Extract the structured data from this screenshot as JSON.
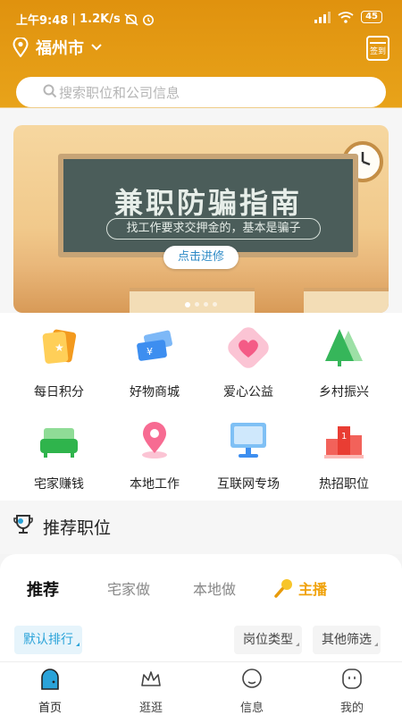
{
  "status_bar": {
    "time": "上午9:48",
    "speed": "1.2K/s",
    "battery": "45"
  },
  "header": {
    "city": "福州市",
    "signin_label": "签到"
  },
  "search": {
    "placeholder": "搜索职位和公司信息"
  },
  "banner": {
    "title": "兼职防骗指南",
    "subtitle": "找工作要求交押金的，基本是骗子",
    "button": "点击进修"
  },
  "grid": [
    {
      "label": "每日积分",
      "icon": "calendar-card-icon"
    },
    {
      "label": "好物商城",
      "icon": "tickets-icon"
    },
    {
      "label": "爱心公益",
      "icon": "heart-icon"
    },
    {
      "label": "乡村振兴",
      "icon": "tree-icon"
    },
    {
      "label": "宅家赚钱",
      "icon": "sofa-icon"
    },
    {
      "label": "本地工作",
      "icon": "location-pin-icon"
    },
    {
      "label": "互联网专场",
      "icon": "monitor-icon"
    },
    {
      "label": "热招职位",
      "icon": "podium-icon"
    }
  ],
  "recommend": {
    "title": "推荐职位",
    "tabs": [
      "推荐",
      "宅家做",
      "本地做",
      "主播"
    ],
    "filters": {
      "sort": "默认排行",
      "type": "岗位类型",
      "other": "其他筛选"
    }
  },
  "nav": [
    {
      "label": "首页",
      "icon": "home-door-icon"
    },
    {
      "label": "逛逛",
      "icon": "crown-icon"
    },
    {
      "label": "信息",
      "icon": "message-icon"
    },
    {
      "label": "我的",
      "icon": "profile-icon"
    }
  ],
  "colors": {
    "accent": "#e69a12",
    "blue": "#2aa3d9",
    "anchor": "#f0a20b"
  }
}
